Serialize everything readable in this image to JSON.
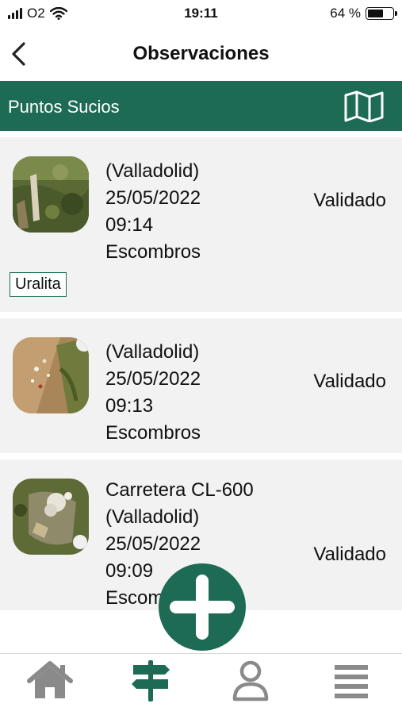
{
  "status_bar": {
    "carrier": "O2",
    "time": "19:11",
    "battery_text": "64 %",
    "battery_level": 0.64
  },
  "header": {
    "title": "Observaciones",
    "back_icon": "chevron-left-icon"
  },
  "section": {
    "title": "Puntos Sucios",
    "map_icon": "map-icon"
  },
  "observations": [
    {
      "lines": [
        " (Valladolid)",
        "25/05/2022",
        "09:14",
        "Escombros"
      ],
      "status": "Validado",
      "tag": "Uralita"
    },
    {
      "lines": [
        " (Valladolid)",
        "25/05/2022",
        "09:13",
        "Escombros"
      ],
      "status": "Validado"
    },
    {
      "lines": [
        "Carretera CL-600",
        "(Valladolid)",
        "25/05/2022",
        "09:09",
        "Escombros"
      ],
      "status": "Validado"
    }
  ],
  "fab": {
    "icon": "plus-icon"
  },
  "tabs": [
    {
      "icon": "home-icon"
    },
    {
      "icon": "signpost-icon",
      "active": true
    },
    {
      "icon": "user-icon"
    },
    {
      "icon": "menu-icon"
    }
  ],
  "colors": {
    "brand_green": "#1d6b55",
    "tab_inactive": "#8a8a8a",
    "card_bg": "#f2f2f2"
  }
}
